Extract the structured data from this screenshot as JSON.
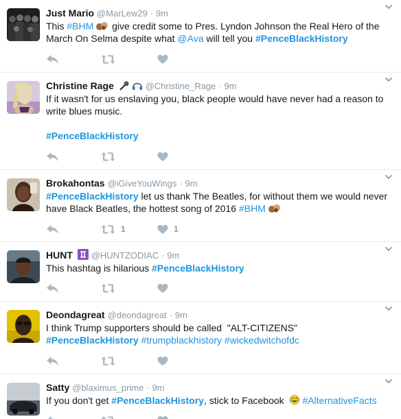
{
  "tweets": [
    {
      "fullname": "Just Mario",
      "handle": "@MarLew29",
      "dot": "·",
      "time": "9m",
      "text_parts": [
        "This ",
        "#BHM",
        " give credit some to Pres. Lyndon Johnson the Real Hero of the March On Selma despite what ",
        "@Ava",
        " will tell you ",
        "#PenceBlackHistory"
      ],
      "retweets": "",
      "likes": ""
    },
    {
      "fullname": "Christine Rage",
      "handle": "@Christine_Rage",
      "dot": "·",
      "time": "9m",
      "text_parts": [
        "If it wasn't for us enslaving you, black people would have never had a reason to write blues music.",
        "#PenceBlackHistory"
      ],
      "retweets": "",
      "likes": ""
    },
    {
      "fullname": "Brokahontas",
      "handle": "@iGiveYouWings",
      "dot": "·",
      "time": "9m",
      "text_parts": [
        "#PenceBlackHistory",
        " let us thank The Beatles, for without them we would never have Black Beatles, the hottest song of 2016 ",
        "#BHM"
      ],
      "retweets": "1",
      "likes": "1"
    },
    {
      "fullname": "HUNT",
      "handle": "@HUNTZODIAC",
      "dot": "·",
      "time": "9m",
      "text_parts": [
        "This hashtag is hilarious ",
        "#PenceBlackHistory"
      ],
      "retweets": "",
      "likes": ""
    },
    {
      "fullname": "Deondagreat",
      "handle": "@deondagreat",
      "dot": "·",
      "time": "9m",
      "text_parts": [
        "I think Trump supporters should be called  \"ALT-CITIZENS\"",
        "#PenceBlackHistory",
        "#trumpblackhistory",
        "#wickedwitchofdc"
      ],
      "retweets": "",
      "likes": ""
    },
    {
      "fullname": "Satty",
      "handle": "@blaximus_prime",
      "dot": "·",
      "time": "9m",
      "text_parts": [
        "If you don't get ",
        "#PenceBlackHistory",
        ", stick to Facebook ",
        "#AlternativeFacts"
      ],
      "retweets": "",
      "likes": ""
    }
  ],
  "icons": {
    "reply": "reply-icon",
    "retweet": "retweet-icon",
    "like": "heart-icon",
    "more": "chevron-down-icon"
  },
  "colors": {
    "link": "#1b95e0",
    "muted": "#8899a6",
    "action": "#aab8c2",
    "divider": "#e6ecf0"
  }
}
